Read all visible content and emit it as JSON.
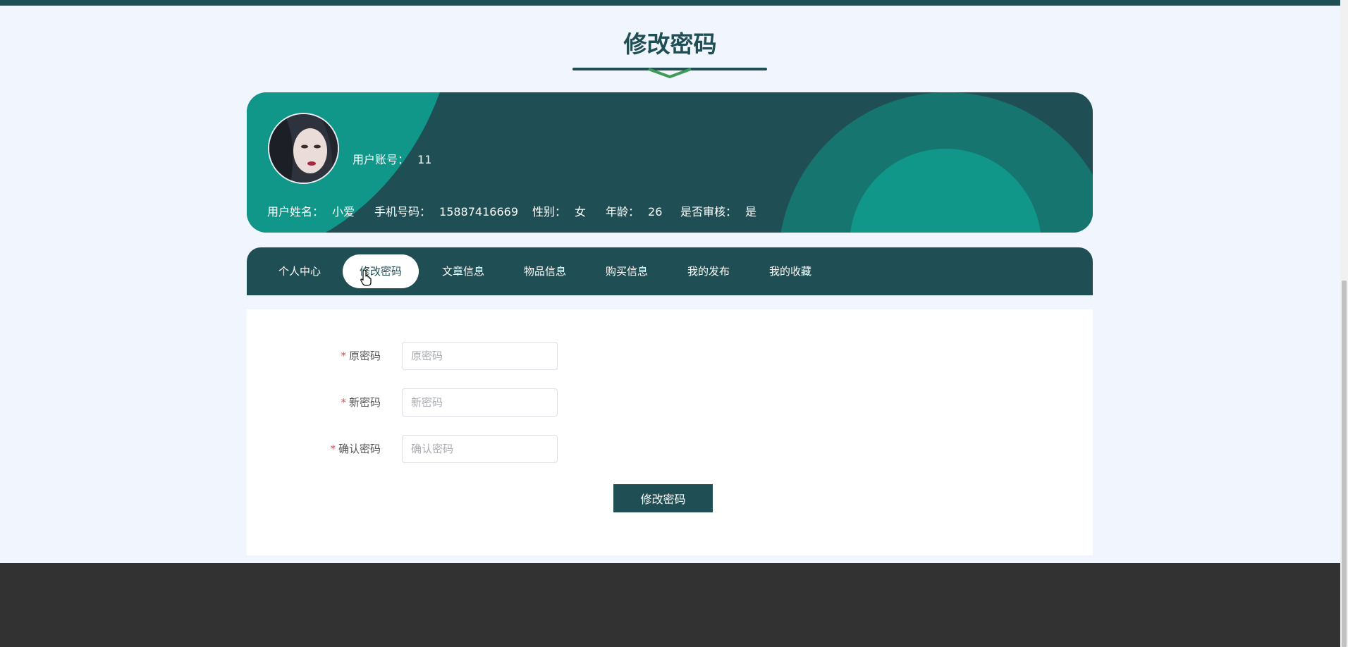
{
  "page": {
    "title": "修改密码"
  },
  "profile": {
    "account_label": "用户账号：",
    "account_value": "11",
    "name_label": "用户姓名：",
    "name_value": "小爱",
    "phone_label": "手机号码：",
    "phone_value": "15887416669",
    "gender_label": "性别：",
    "gender_value": "女",
    "age_label": "年龄：",
    "age_value": "26",
    "audited_label": "是否审核：",
    "audited_value": "是"
  },
  "tabs": [
    {
      "label": "个人中心",
      "active": false
    },
    {
      "label": "修改密码",
      "active": true
    },
    {
      "label": "文章信息",
      "active": false
    },
    {
      "label": "物品信息",
      "active": false
    },
    {
      "label": "购买信息",
      "active": false
    },
    {
      "label": "我的发布",
      "active": false
    },
    {
      "label": "我的收藏",
      "active": false
    }
  ],
  "form": {
    "required_mark": "*",
    "old_password": {
      "label": "原密码",
      "placeholder": "原密码",
      "value": ""
    },
    "new_password": {
      "label": "新密码",
      "placeholder": "新密码",
      "value": ""
    },
    "confirm_password": {
      "label": "确认密码",
      "placeholder": "确认密码",
      "value": ""
    },
    "submit_label": "修改密码"
  },
  "colors": {
    "primary": "#1f4f54",
    "accent_teal": "#11968a",
    "page_bg": "#f1f5fe",
    "footer_bg": "#323232",
    "required": "#e05050"
  }
}
